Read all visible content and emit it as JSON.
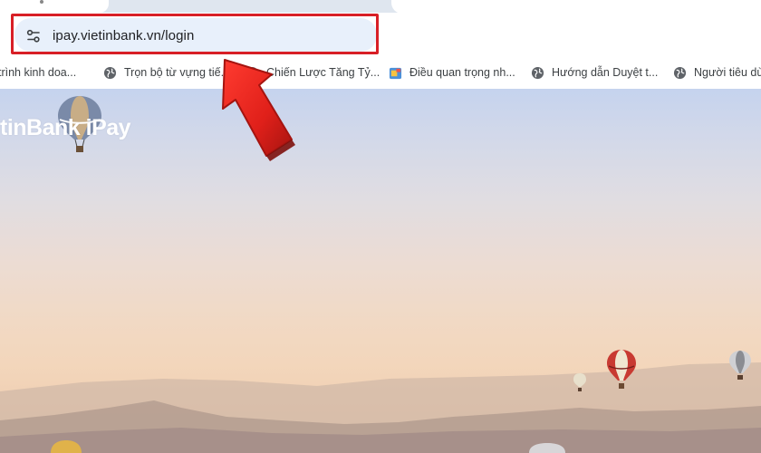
{
  "browser": {
    "url": "ipay.vietinbank.vn/login",
    "site_info_icon": "tune-icon",
    "highlight_color": "#d81f26"
  },
  "bookmarks": [
    {
      "label": "trình kinh doa...",
      "icon": "none"
    },
    {
      "label": "Trọn bộ từ vựng tiế...",
      "icon": "globe-icon"
    },
    {
      "label": "Chiến Lược Tăng Tỷ...",
      "icon": "globe-icon"
    },
    {
      "label": "Điều quan trọng nh...",
      "icon": "app-icon"
    },
    {
      "label": "Hướng dẫn Duyệt t...",
      "icon": "globe-icon"
    },
    {
      "label": "Người tiêu dù",
      "icon": "globe-icon"
    }
  ],
  "page": {
    "brand": "tinBank iPay",
    "background_icon": "hot-air-balloon-icon"
  },
  "annotation": {
    "arrow_color": "#d81f26",
    "arrow_icon": "pointer-arrow-icon"
  }
}
